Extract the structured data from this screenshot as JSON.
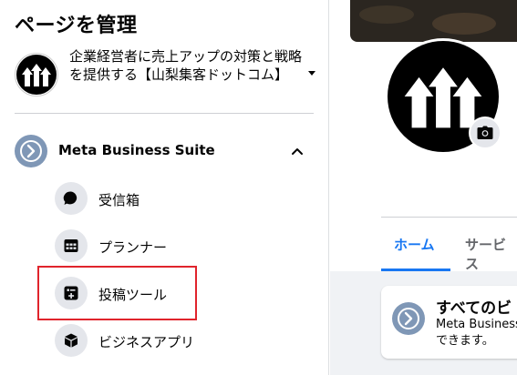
{
  "sidebar": {
    "heading": "ページを管理",
    "page": {
      "name": "企業経営者に売上アップの対策と戦略を提供する【山梨集客ドットコム】",
      "avatar_icon": "three-up-arrows-logo"
    },
    "suite": {
      "label": "Meta Business Suite",
      "logo_icon": "meta-business-suite-logo",
      "expanded": true
    },
    "items": [
      {
        "label": "受信箱",
        "icon": "chat-bubble-icon"
      },
      {
        "label": "プランナー",
        "icon": "calendar-grid-icon"
      },
      {
        "label": "投稿ツール",
        "icon": "post-tools-icon",
        "highlighted": true
      },
      {
        "label": "ビジネスアプリ",
        "icon": "cube-icon"
      }
    ]
  },
  "main": {
    "tabs": [
      {
        "label": "ホーム",
        "active": true
      },
      {
        "label": "サービス",
        "active": false
      }
    ],
    "about_card": {
      "title": "すべてのビ",
      "text_line1": "Meta Business",
      "text_line2": "できます。"
    }
  },
  "colors": {
    "accent": "#1877f2",
    "highlight_border": "#e0242c",
    "icon_bg": "#e4e6eb",
    "suite_logo": "#7f97b6"
  }
}
